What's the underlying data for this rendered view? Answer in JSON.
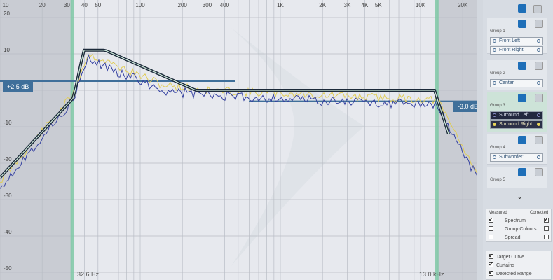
{
  "x_ticks": [
    {
      "label": "10",
      "f": 10
    },
    {
      "label": "20",
      "f": 20
    },
    {
      "label": "30",
      "f": 30
    },
    {
      "label": "40",
      "f": 40
    },
    {
      "label": "50",
      "f": 50
    },
    {
      "label": "100",
      "f": 100
    },
    {
      "label": "200",
      "f": 200
    },
    {
      "label": "300",
      "f": 300
    },
    {
      "label": "400",
      "f": 400
    },
    {
      "label": "1K",
      "f": 1000
    },
    {
      "label": "2K",
      "f": 2000
    },
    {
      "label": "3K",
      "f": 3000
    },
    {
      "label": "4K",
      "f": 4000
    },
    {
      "label": "5K",
      "f": 5000
    },
    {
      "label": "10K",
      "f": 10000
    },
    {
      "label": "20K",
      "f": 20000
    }
  ],
  "y_ticks": [
    "20",
    "10",
    "-10",
    "-20",
    "-30",
    "-40",
    "-50"
  ],
  "y_tick_values": [
    20,
    10,
    -10,
    -20,
    -30,
    -40,
    -50
  ],
  "lower_cutoff_label": "32.6 Hz",
  "upper_cutoff_label": "13.0 kHz",
  "lower_cutoff_hz": 32.6,
  "upper_cutoff_hz": 13000,
  "handle_left_label": "+2.5 dB",
  "handle_right_label": "-3.0 dB",
  "handle_left_db": 2.5,
  "handle_right_db": -3.0,
  "colors": {
    "target": "#1c2a3a",
    "highlight": "#7ec8a4",
    "series_blue": "#3440a0",
    "series_gold": "#e0cc55",
    "handle": "#3f6f9a"
  },
  "groups": [
    {
      "name": "Group 1",
      "channels": [
        "Front Left",
        "Front Right"
      ],
      "selected": false
    },
    {
      "name": "Group 2",
      "channels": [
        "Center"
      ],
      "selected": false
    },
    {
      "name": "Group 3",
      "channels": [
        "Surround Left",
        "Surround Right"
      ],
      "selected": true
    },
    {
      "name": "Group 4",
      "channels": [
        "Subwoofer1"
      ],
      "selected": false
    },
    {
      "name": "Group 5",
      "channels": [],
      "selected": false
    }
  ],
  "measured_label": "Measured",
  "corrected_label": "Corrected",
  "view_options": [
    {
      "label": "Spectrum",
      "measured": true,
      "corrected": true
    },
    {
      "label": "Group Colours",
      "measured": false,
      "corrected": false
    },
    {
      "label": "Spread",
      "measured": false,
      "corrected": false
    }
  ],
  "overlay_options": [
    {
      "label": "Target Curve",
      "checked": true
    },
    {
      "label": "Curtains",
      "checked": true
    },
    {
      "label": "Detected Range",
      "checked": true
    }
  ]
}
